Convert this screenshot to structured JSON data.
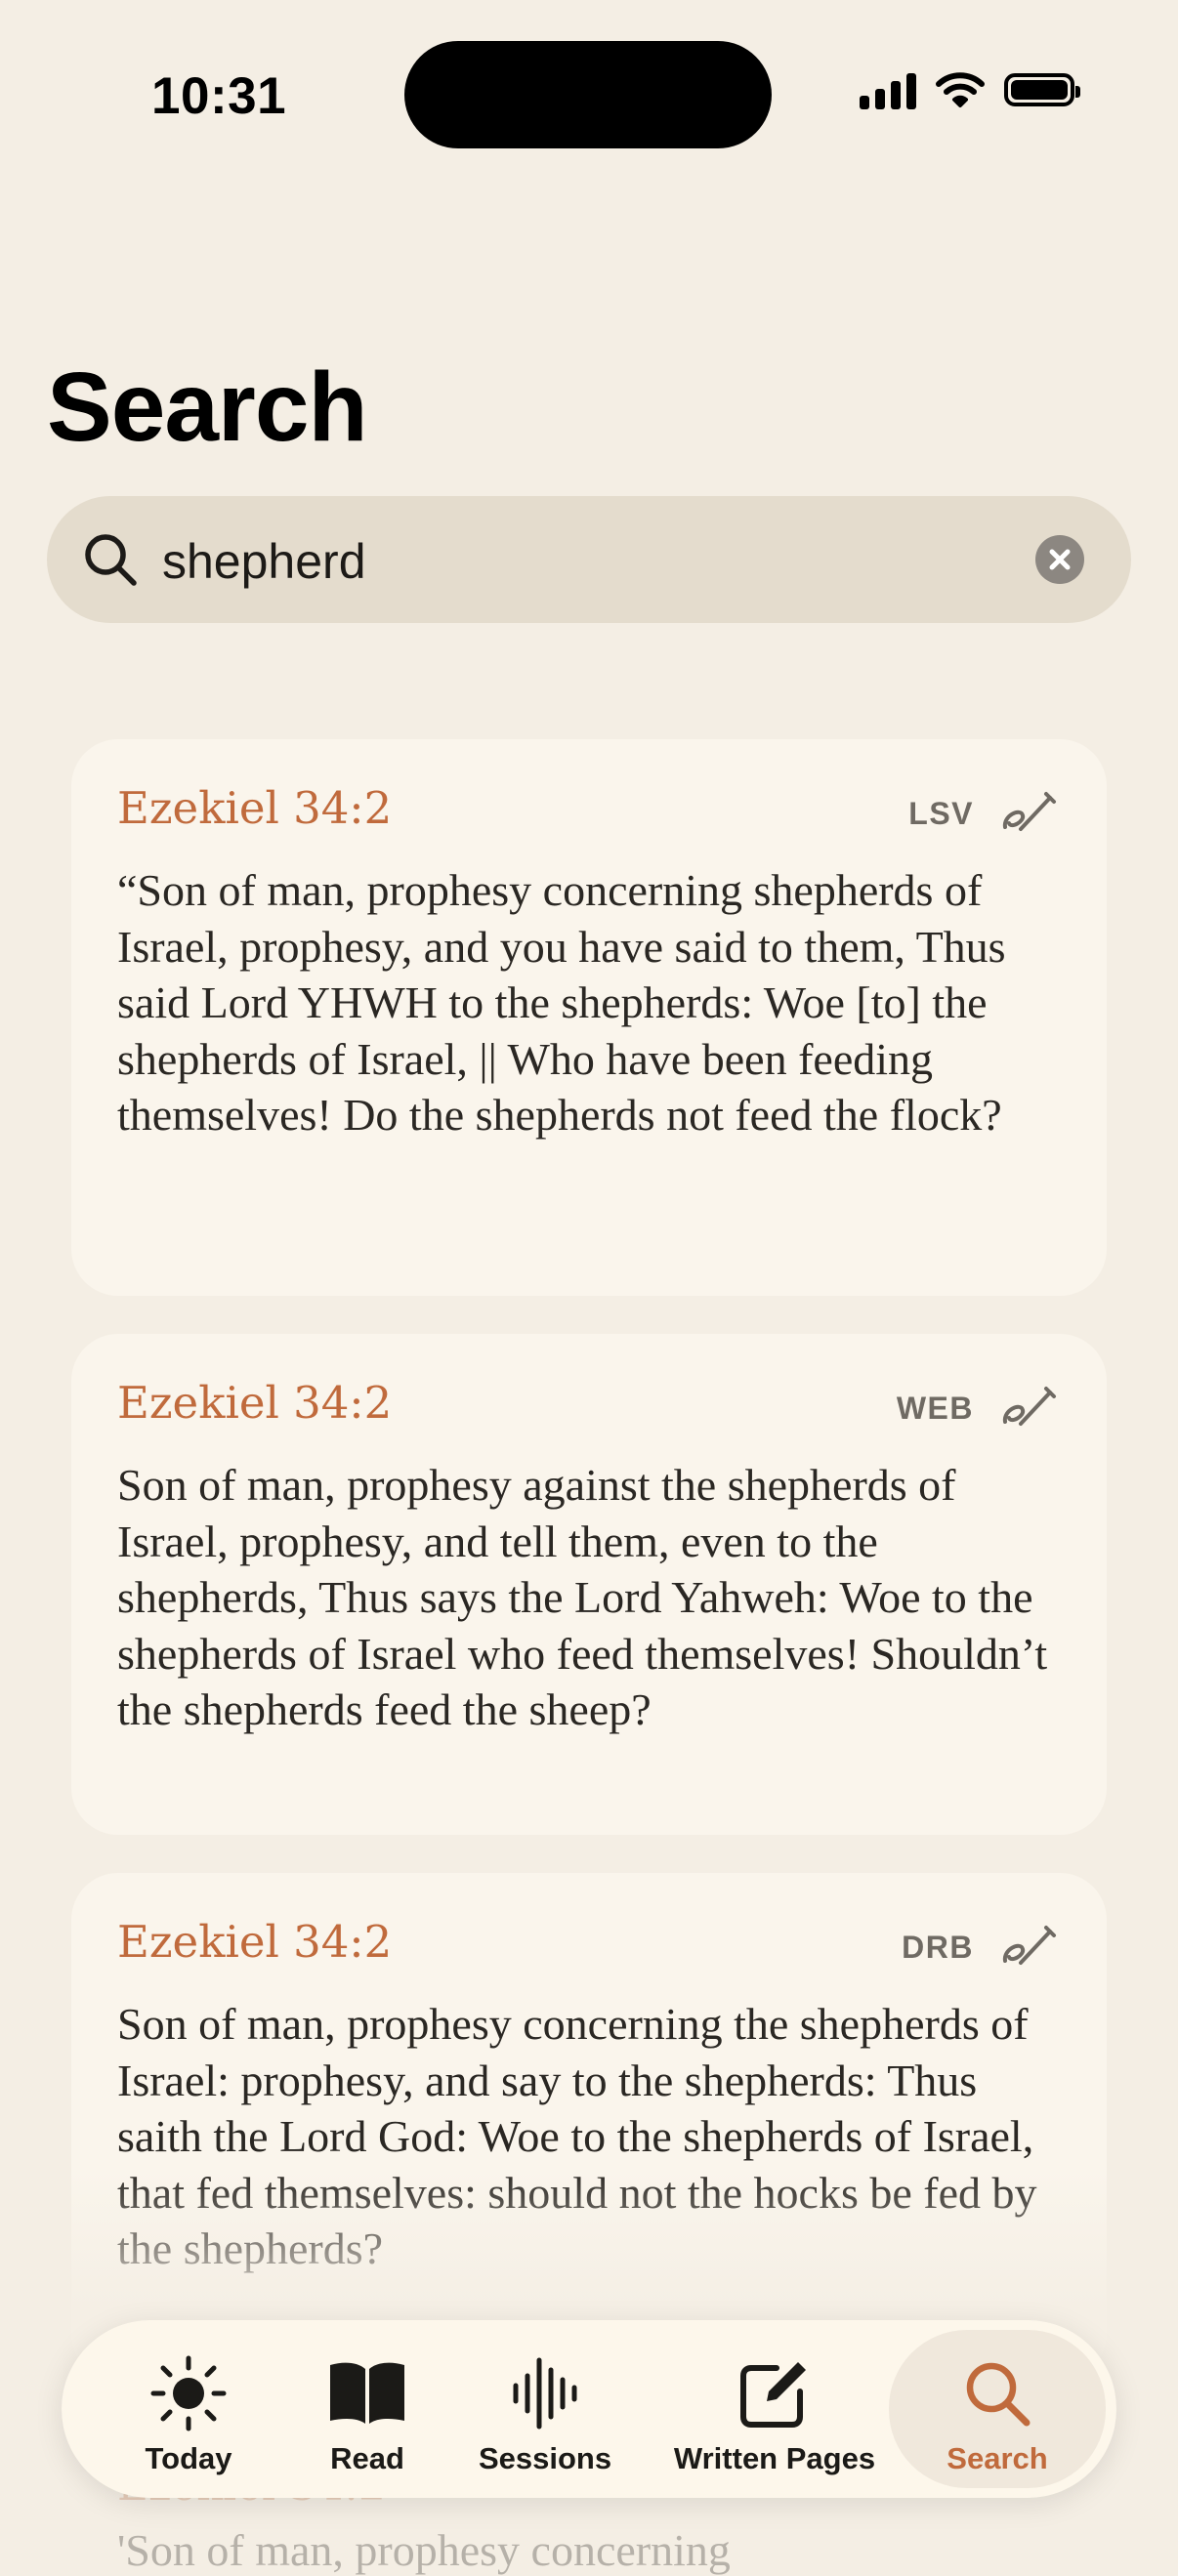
{
  "status_bar": {
    "time": "10:31",
    "icons": [
      "cellular-signal-icon",
      "wifi-icon",
      "battery-icon"
    ]
  },
  "page": {
    "title": "Search"
  },
  "search": {
    "query": "shepherd",
    "icon": "search-icon",
    "clear_icon": "clear-icon"
  },
  "results": [
    {
      "reference": "Ezekiel 34:2",
      "version": "LSV",
      "text": "“Son of man, prophesy concerning shepherds of Israel, prophesy, and you have said to them, Thus said Lord YHWH to the shepherds: Woe [to] the shepherds of Israel, || Who have been feeding themselves! Do the shepherds not feed the flock?"
    },
    {
      "reference": "Ezekiel 34:2",
      "version": "WEB",
      "text": "Son of man, prophesy against the shepherds of Israel, prophesy, and tell them, even to the shepherds, Thus says the Lord Yahweh: Woe to the shepherds of Israel who feed themselves! Shouldn’t the shepherds feed the sheep?"
    },
    {
      "reference": "Ezekiel 34:2",
      "version": "DRB",
      "text": "Son of man, prophesy concerning the shepherds of Israel: prophesy, and say to the shepherds: Thus saith the Lord God: Woe to the shepherds of Israel, that fed themselves: should not the hocks be fed by the shepherds?"
    }
  ],
  "partial_result": {
    "reference": "Ezekiel 34:2",
    "text": "'Son of man, prophesy concerning"
  },
  "tab_bar": {
    "items": [
      {
        "label": "Today",
        "icon": "sun-icon"
      },
      {
        "label": "Read",
        "icon": "book-icon"
      },
      {
        "label": "Sessions",
        "icon": "waveform-icon"
      },
      {
        "label": "Written Pages",
        "icon": "compose-icon"
      },
      {
        "label": "Search",
        "icon": "search-icon",
        "active": true
      }
    ]
  },
  "colors": {
    "accent": "#c06a3c",
    "background": "#f4eee4",
    "card": "#faf5ec",
    "search_field": "#e4dccd"
  }
}
